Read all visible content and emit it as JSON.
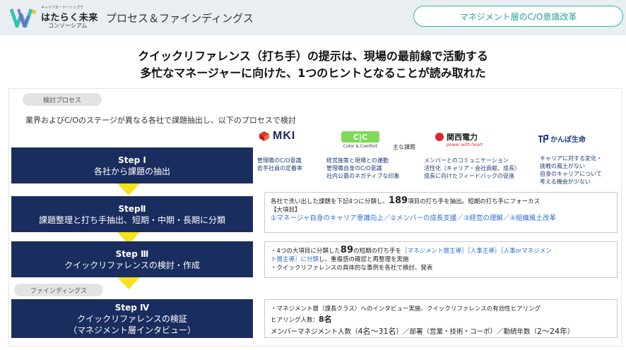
{
  "header": {
    "logo_small": "キャリアオーナーシップで",
    "logo_main": "はたらく未来",
    "logo_sub": "コンソーシアム",
    "title": "プロセス＆ファインディングス",
    "badge": "マネジメント層のC/O意識改革"
  },
  "headline": {
    "line1": "クイックリファレンス（打ち手）の提示は、現場の最前線で活動する",
    "line2": "多忙なマネージャーに向けた、1つのヒントとなることが読み取れた"
  },
  "process_pill": "検討プロセス",
  "findings_pill": "ファインディングス",
  "intro": "業界およびC/Oのステージが異なる各社で課題抽出し、以下のプロセスで検討",
  "steps": [
    {
      "label": "Step Ⅰ",
      "line1": "各社から課題の抽出",
      "line2": ""
    },
    {
      "label": "StepⅡ",
      "line1": "課題整理と打ち手抽出、短期・中期・長期に分類",
      "line2": ""
    },
    {
      "label": "Step Ⅲ",
      "line1": "クイックリファレンスの検討・作成",
      "line2": ""
    },
    {
      "label": "Step Ⅳ",
      "line1": "クイックリファレンスの検証",
      "line2": "（マネジメント層インタビュー）"
    }
  ],
  "main_issues_label": "主な課題",
  "companies": [
    {
      "logo": "MKI",
      "issues": [
        "管理職のC/O意識",
        "若手社員の定着率"
      ]
    },
    {
      "logo": "C|C",
      "logo_sub": "Color & Comfort",
      "issues": [
        "経営施策と現場との連動",
        "管理職自身のC/O意識",
        "社内公募のネガティブな印象"
      ]
    },
    {
      "logo": "関西電力",
      "logo_sub": "power with heart",
      "issues": [
        "メンバーとのコミュニケーション",
        "活性化（キャリア・会社貢献、成長）",
        "成長に向けたフィードバックの促進"
      ]
    },
    {
      "logo": "かんぽ生命",
      "issues": [
        "キャリアに対する変化・",
        "挑戦の風土がない",
        "自身のキャリアについて",
        "考える機会が少ない"
      ]
    }
  ],
  "detail2": {
    "pre": "各社で洗い出した課題を下記4つに分類し、",
    "number": "189",
    "post": "項目の打ち手を抽出。短期の打ち手にフォーカス",
    "heading": "【大項目】",
    "categories": "①マネージャ自身のキャリア意識向上／②メンバーの成長支援／③経営の理解／④組織風土改革"
  },
  "detail3": {
    "pre": "・4つの大項目に分類した",
    "number": "89",
    "mid": "の短期の打ち手を",
    "blue1": "［マネジメント層主導］［人事主導］［人事orマネジメン",
    "blue2": "ト層主導］に分類",
    "post": "し、重複感の確認と再整理を実施",
    "line3": "・クイックリファレンスの具体的な事例を各社で検討、発表"
  },
  "detail4": {
    "line1": "・マネジメント層（課長クラス）へのインタビュー実施、クイックリファレンスの有効性ヒアリング",
    "count_label": "ヒアリング人数：",
    "count_value": "8名",
    "line3_pre": "メンバーマネジメント人数（",
    "line3_a": "4名～31名",
    "line3_mid": "）／部署（営業・技術・コーポ）／勤続年数（",
    "line3_b": "2～24年",
    "line3_post": "）"
  },
  "colors": {
    "step_bg": "#1a2d5f",
    "arrow": "#f7e21b",
    "accent": "#2eb8a6",
    "blue_text": "#2f6fd1"
  }
}
